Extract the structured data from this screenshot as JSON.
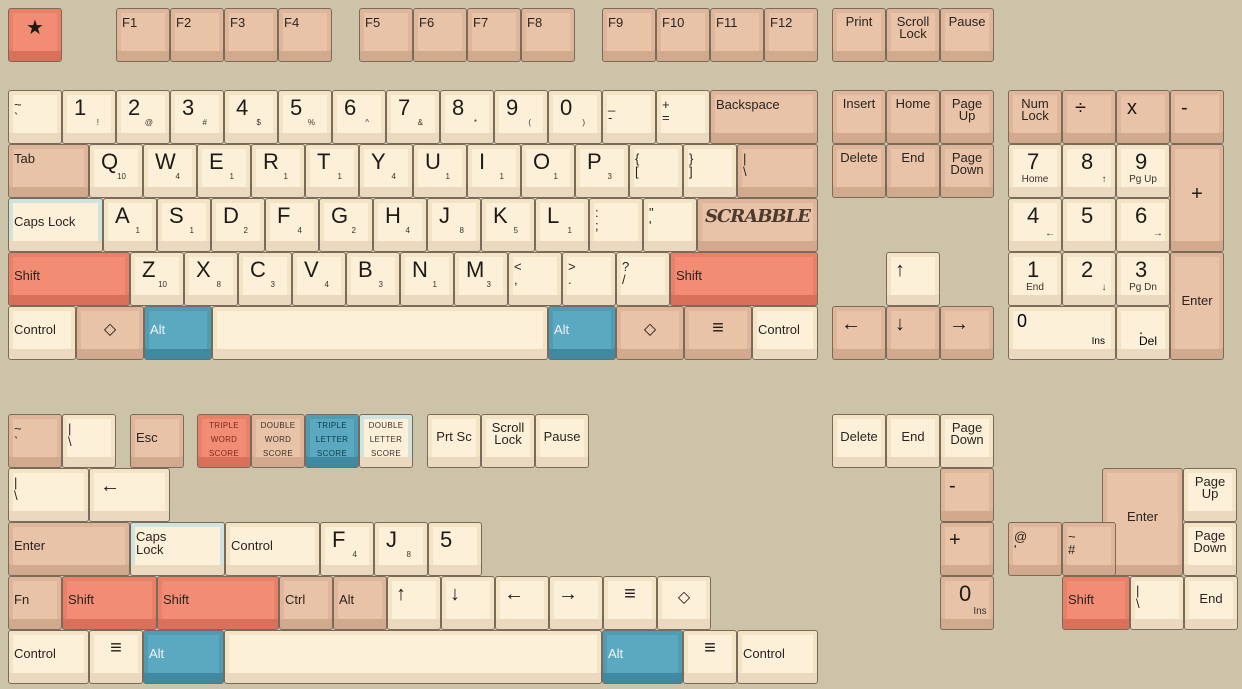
{
  "keys": {
    "star": "★",
    "f1": "F1",
    "f2": "F2",
    "f3": "F3",
    "f4": "F4",
    "f5": "F5",
    "f6": "F6",
    "f7": "F7",
    "f8": "F8",
    "f9": "F9",
    "f10": "F10",
    "f11": "F11",
    "f12": "F12",
    "print": "Print",
    "scroll_lock": "Scroll\nLock",
    "pause": "Pause",
    "tilde": "~\n`",
    "n1": "1",
    "n1s": "!",
    "n2": "2",
    "n2s": "@",
    "n3": "3",
    "n3s": "#",
    "n4": "4",
    "n4s": "$",
    "n5": "5",
    "n5s": "%",
    "n6": "6",
    "n6s": "^",
    "n7": "7",
    "n7s": "&",
    "n8": "8",
    "n8s": "*",
    "n9": "9",
    "n9s": "(",
    "n0": "0",
    "n0s": ")",
    "minus": "_\n-",
    "equals": "+\n=",
    "backspace": "Backspace",
    "tab": "Tab",
    "q": "Q",
    "q_v": "10",
    "w": "W",
    "w_v": "4",
    "e": "E",
    "e_v": "1",
    "r": "R",
    "r_v": "1",
    "t": "T",
    "t_v": "1",
    "y": "Y",
    "y_v": "4",
    "u": "U",
    "u_v": "1",
    "i": "I",
    "i_v": "1",
    "o": "O",
    "o_v": "1",
    "p": "P",
    "p_v": "3",
    "lbracket": "{\n[",
    "rbracket": "}\n]",
    "backslash": "|\n\\",
    "caps_lock": "Caps Lock",
    "a": "A",
    "a_v": "1",
    "s": "S",
    "s_v": "1",
    "d": "D",
    "d_v": "2",
    "f": "F",
    "f_v": "4",
    "g": "G",
    "g_v": "2",
    "h": "H",
    "h_v": "4",
    "j": "J",
    "j_v": "8",
    "k": "K",
    "k_v": "5",
    "l": "L",
    "l_v": "1",
    "semicolon": ":\n;",
    "quote": "\"\n'",
    "logo": "SCRABBLE",
    "shift": "Shift",
    "z": "Z",
    "z_v": "10",
    "x": "X",
    "x_v": "8",
    "c": "C",
    "c_v": "3",
    "v": "V",
    "v_v": "4",
    "b": "B",
    "b_v": "3",
    "n": "N",
    "n_v": "1",
    "m": "M",
    "m_v": "3",
    "comma": "<\n,",
    "period": ">\n.",
    "slash": "?\n/",
    "control": "Control",
    "diamond": "◇",
    "alt": "Alt",
    "menu": "≡",
    "insert": "Insert",
    "home": "Home",
    "page_up": "Page\nUp",
    "delete": "Delete",
    "end": "End",
    "page_down": "Page\nDown",
    "up": "↑",
    "down": "↓",
    "left": "←",
    "right": "→",
    "num_lock": "Num\nLock",
    "divide": "÷",
    "multiply": "x",
    "kp_minus": "-",
    "kp7": "7",
    "kp7s": "Home",
    "kp8": "8",
    "kp8s": "↑",
    "kp9": "9",
    "kp9s": "Pg Up",
    "kp_plus": "+",
    "kp4": "4",
    "kp4s": "←",
    "kp5": "5",
    "kp6": "6",
    "kp6s": "→",
    "kp1": "1",
    "kp1s": "End",
    "kp2": "2",
    "kp2s": "↓",
    "kp3": "3",
    "kp3s": "Pg Dn",
    "kp_enter": "Enter",
    "kp0": "0",
    "kp0s": "Ins",
    "kp_dot": ".",
    "kp_dots": "Del",
    "esc": "Esc",
    "tws": "TRIPLE\nWORD\nSCORE",
    "dws": "DOUBLE\nWORD\nSCORE",
    "tls": "TRIPLE\nLETTER\nSCORE",
    "dls": "DOUBLE\nLETTER\nSCORE",
    "prt_sc": "Prt Sc",
    "pause2": "Pause",
    "bar": "|\n\\",
    "left_arrow": "←",
    "enter": "Enter",
    "caps2": "Caps\nLock",
    "fn": "Fn",
    "ctrl": "Ctrl",
    "five": "5",
    "kp_minus2": "-",
    "kp_plus2": "+",
    "kp_zero2": "0",
    "kp_zero2s": "Ins",
    "at": "@\n'",
    "hash": "~\n#",
    "enter2": "Enter"
  }
}
